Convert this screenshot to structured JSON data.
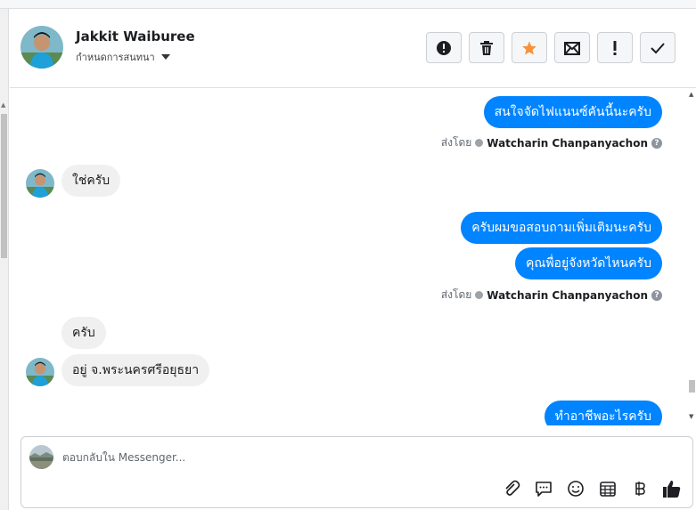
{
  "header": {
    "contact_name": "Jakkit Waiburee",
    "manage_label": "กำหนดการสนทนา"
  },
  "messages": {
    "m1": "สนใจจัดไฟแนนซ์คันนี้นะครับ",
    "m2": "ใช่ครับ",
    "m3": "ครับผมขอสอบถามเพิ่มเติมนะครับ",
    "m4": "คุณพื่อยู่จังหวัดไหนครับ",
    "m5": "ครับ",
    "m6": "อยู่ จ.พระนครศรีอยุธยา",
    "m7": "ทำอาชีพอะไรครับ"
  },
  "sent_by": {
    "label": "ส่งโดย",
    "agent": "Watcharin Chanpanyachon",
    "info": "?"
  },
  "composer": {
    "placeholder": "ตอบกลับใน Messenger..."
  },
  "icons": {
    "toolbar": [
      "spam-report-icon",
      "trash-icon",
      "star-icon",
      "mark-unread-icon",
      "follow-up-icon",
      "done-check-icon"
    ],
    "composer": [
      "attach-icon",
      "saved-reply-icon",
      "emoji-icon",
      "appointment-icon",
      "payment-icon",
      "like-icon"
    ]
  },
  "colors": {
    "outgoing_bubble": "#0084ff",
    "incoming_bubble": "#f0f0f0",
    "star": "#f7923b"
  }
}
